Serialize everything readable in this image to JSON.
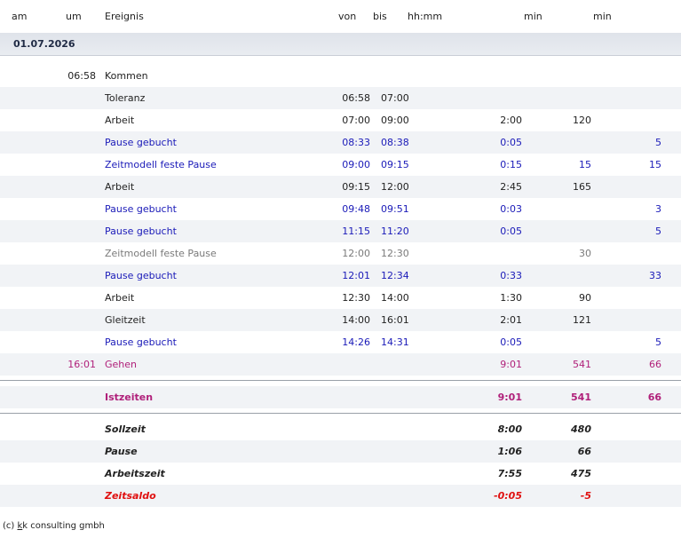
{
  "header": {
    "am": "am",
    "um": "um",
    "ereignis": "Ereignis",
    "von": "von",
    "bis": "bis",
    "hhmm": "hh:mm",
    "min1": "min",
    "min2": "min"
  },
  "date": "01.07.2026",
  "colors": {
    "normal": "#222222",
    "booked": "#1a1ab8",
    "grey": "#7a7a7a",
    "gehen": "#b0207a",
    "istzeiten": "#b0207a",
    "saldo": "#e01010",
    "alt_row": "#f1f3f6"
  },
  "rows": [
    {
      "um": "06:58",
      "ereignis": "Kommen",
      "von": "",
      "bis": "",
      "hhmm": "",
      "min1": "",
      "min2": "",
      "style": "normal"
    },
    {
      "um": "",
      "ereignis": "Toleranz",
      "von": "06:58",
      "bis": "07:00",
      "hhmm": "",
      "min1": "",
      "min2": "",
      "style": "normal"
    },
    {
      "um": "",
      "ereignis": "Arbeit",
      "von": "07:00",
      "bis": "09:00",
      "hhmm": "2:00",
      "min1": "120",
      "min2": "",
      "style": "normal"
    },
    {
      "um": "",
      "ereignis": "Pause gebucht",
      "von": "08:33",
      "bis": "08:38",
      "hhmm": "0:05",
      "min1": "",
      "min2": "5",
      "style": "booked"
    },
    {
      "um": "",
      "ereignis": "Zeitmodell feste Pause",
      "von": "09:00",
      "bis": "09:15",
      "hhmm": "0:15",
      "min1": "15",
      "min2": "15",
      "style": "booked"
    },
    {
      "um": "",
      "ereignis": "Arbeit",
      "von": "09:15",
      "bis": "12:00",
      "hhmm": "2:45",
      "min1": "165",
      "min2": "",
      "style": "normal"
    },
    {
      "um": "",
      "ereignis": "Pause gebucht",
      "von": "09:48",
      "bis": "09:51",
      "hhmm": "0:03",
      "min1": "",
      "min2": "3",
      "style": "booked"
    },
    {
      "um": "",
      "ereignis": "Pause gebucht",
      "von": "11:15",
      "bis": "11:20",
      "hhmm": "0:05",
      "min1": "",
      "min2": "5",
      "style": "booked"
    },
    {
      "um": "",
      "ereignis": "Zeitmodell feste Pause",
      "von": "12:00",
      "bis": "12:30",
      "hhmm": "",
      "min1": "30",
      "min2": "",
      "style": "grey"
    },
    {
      "um": "",
      "ereignis": "Pause gebucht",
      "von": "12:01",
      "bis": "12:34",
      "hhmm": "0:33",
      "min1": "",
      "min2": "33",
      "style": "booked"
    },
    {
      "um": "",
      "ereignis": "Arbeit",
      "von": "12:30",
      "bis": "14:00",
      "hhmm": "1:30",
      "min1": "90",
      "min2": "",
      "style": "normal"
    },
    {
      "um": "",
      "ereignis": "Gleitzeit",
      "von": "14:00",
      "bis": "16:01",
      "hhmm": "2:01",
      "min1": "121",
      "min2": "",
      "style": "normal"
    },
    {
      "um": "",
      "ereignis": "Pause gebucht",
      "von": "14:26",
      "bis": "14:31",
      "hhmm": "0:05",
      "min1": "",
      "min2": "5",
      "style": "booked"
    },
    {
      "um": "16:01",
      "ereignis": "Gehen",
      "von": "",
      "bis": "",
      "hhmm": "9:01",
      "min1": "541",
      "min2": "66",
      "style": "gehen"
    }
  ],
  "istzeiten": {
    "label": "Istzeiten",
    "hhmm": "9:01",
    "min1": "541",
    "min2": "66"
  },
  "summary": [
    {
      "label": "Sollzeit",
      "hhmm": "8:00",
      "min1": "480",
      "style": "normal"
    },
    {
      "label": "Pause",
      "hhmm": "1:06",
      "min1": "66",
      "style": "normal"
    },
    {
      "label": "Arbeitszeit",
      "hhmm": "7:55",
      "min1": "475",
      "style": "normal"
    },
    {
      "label": "Zeitsaldo",
      "hhmm": "-0:05",
      "min1": "-5",
      "style": "saldo"
    }
  ],
  "footer": {
    "prefix": "(c) ",
    "k": "k",
    "suffix": "k consulting gmbh"
  }
}
